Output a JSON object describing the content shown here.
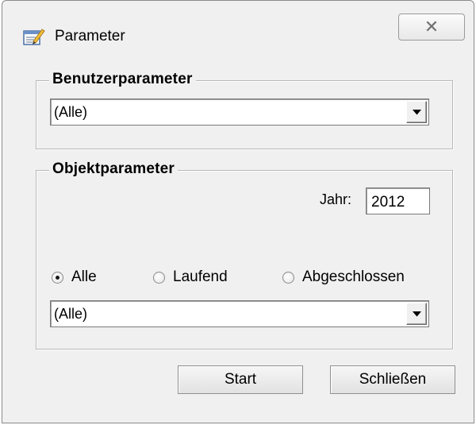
{
  "window": {
    "title": "Parameter",
    "close_glyph": "✕",
    "title_icon": "edit-form-icon"
  },
  "benutzer": {
    "legend": "Benutzerparameter",
    "combo_value": "(Alle)"
  },
  "objekt": {
    "legend": "Objektparameter",
    "jahr_label": "Jahr:",
    "jahr_value": "2012",
    "radios": [
      {
        "label": "Alle",
        "checked": true
      },
      {
        "label": "Laufend",
        "checked": false
      },
      {
        "label": "Abgeschlossen",
        "checked": false
      }
    ],
    "combo_value": "(Alle)"
  },
  "buttons": {
    "start": "Start",
    "close": "Schließen"
  }
}
